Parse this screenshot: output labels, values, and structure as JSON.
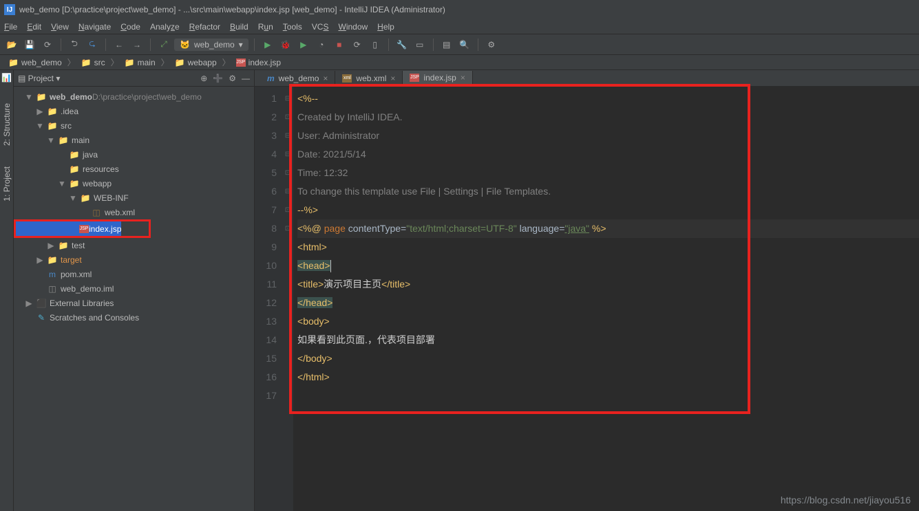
{
  "title": "web_demo [D:\\practice\\project\\web_demo] - ...\\src\\main\\webapp\\index.jsp [web_demo] - IntelliJ IDEA (Administrator)",
  "menu": [
    "File",
    "Edit",
    "View",
    "Navigate",
    "Code",
    "Analyze",
    "Refactor",
    "Build",
    "Run",
    "Tools",
    "VCS",
    "Window",
    "Help"
  ],
  "runConfig": "web_demo",
  "crumbs": [
    {
      "icon": "folder",
      "label": "web_demo"
    },
    {
      "icon": "folder",
      "label": "src"
    },
    {
      "icon": "folder",
      "label": "main"
    },
    {
      "icon": "folder",
      "label": "webapp"
    },
    {
      "icon": "jsp",
      "label": "index.jsp"
    }
  ],
  "sidebar": {
    "struct": "2: Structure",
    "proj": "1: Project"
  },
  "projectHeader": {
    "title": "Project",
    "dd": "▾"
  },
  "tree": [
    {
      "ind": 1,
      "arr": "▼",
      "icon": "folder",
      "label": "web_demo",
      "suffix": "D:\\practice\\project\\web_demo",
      "bold": true
    },
    {
      "ind": 2,
      "arr": "▶",
      "icon": "folder",
      "label": ".idea"
    },
    {
      "ind": 2,
      "arr": "▼",
      "icon": "folder",
      "label": "src"
    },
    {
      "ind": 3,
      "arr": "▼",
      "icon": "folder",
      "label": "main"
    },
    {
      "ind": 4,
      "arr": "",
      "icon": "folder-b",
      "label": "java"
    },
    {
      "ind": 4,
      "arr": "",
      "icon": "folder-r",
      "label": "resources"
    },
    {
      "ind": 4,
      "arr": "▼",
      "icon": "folder-w",
      "label": "webapp"
    },
    {
      "ind": 5,
      "arr": "▼",
      "icon": "folder",
      "label": "WEB-INF"
    },
    {
      "ind": 6,
      "arr": "",
      "icon": "xml",
      "label": "web.xml"
    },
    {
      "ind": 5,
      "arr": "",
      "icon": "jsp",
      "label": "index.jsp",
      "sel": true,
      "hl": true
    },
    {
      "ind": 3,
      "arr": "▶",
      "icon": "folder",
      "label": "test"
    },
    {
      "ind": 2,
      "arr": "▶",
      "icon": "folder-o",
      "label": "target",
      "orange": true
    },
    {
      "ind": 2,
      "arr": "",
      "icon": "m",
      "label": "pom.xml"
    },
    {
      "ind": 2,
      "arr": "",
      "icon": "file",
      "label": "web_demo.iml"
    },
    {
      "ind": 1,
      "arr": "▶",
      "icon": "lib",
      "label": "External Libraries"
    },
    {
      "ind": 1,
      "arr": "",
      "icon": "scratch",
      "label": "Scratches and Consoles"
    }
  ],
  "tabs": [
    {
      "icon": "m",
      "label": "web_demo"
    },
    {
      "icon": "xml",
      "label": "web.xml"
    },
    {
      "icon": "jsp",
      "label": "index.jsp",
      "active": true
    }
  ],
  "code": {
    "lines": 17,
    "l1": "<%--",
    "l2": "  Created by IntelliJ IDEA.",
    "l3": "  User: Administrator",
    "l4": "  Date: 2021/5/14",
    "l5": "  Time: 12:32",
    "l6": "  To change this template use File | Settings | File Templates.",
    "l7": "--%>",
    "l8a": "<%@ ",
    "l8b": "page",
    "l8c": " contentType=",
    "l8d": "\"text/html;charset=UTF-8\"",
    "l8e": " language=",
    "l8f": "\"java\"",
    "l8g": " %>",
    "l9a": "<",
    "l9b": "html",
    "l9c": ">",
    "l10a": "<",
    "l10b": "head",
    "l10c": ">",
    "l11a": "    <",
    "l11b": "title",
    "l11c": ">",
    "l11d": "演示项目主页",
    "l11e": "</",
    "l11f": "title",
    "l11g": ">",
    "l12a": "</",
    "l12b": "head",
    "l12c": ">",
    "l13a": "<",
    "l13b": "body",
    "l13c": ">",
    "l14": "如果看到此页面.，代表项目部署",
    "l15a": "</",
    "l15b": "body",
    "l15c": ">",
    "l16a": "</",
    "l16b": "html",
    "l16c": ">"
  },
  "watermark": "https://blog.csdn.net/jiayou516"
}
